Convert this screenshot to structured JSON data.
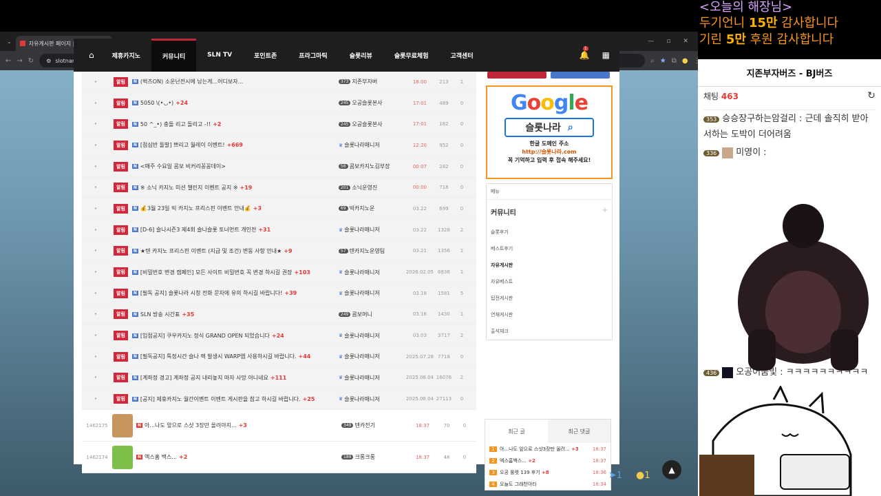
{
  "browser": {
    "tab_title": "자유게시판 페이지 | 슬롯나라",
    "url": "slotnara2.com/free"
  },
  "nav": {
    "items": [
      "제휴카지노",
      "커뮤니티",
      "SLN TV",
      "포인트존",
      "프라그마틱",
      "슬롯리뷰",
      "슬롯무료체험",
      "고객센터"
    ],
    "bell_count": "1"
  },
  "board": {
    "notice_label": "알림",
    "n_icon": "N",
    "notices": [
      {
        "title": "(벅즈ON) 소운난전시에 남는게...어디보자...",
        "cmt": "",
        "lvl": "373",
        "writer": "지존부자버",
        "date": "18:00",
        "date_red": true,
        "views": "213",
        "likes": "1"
      },
      {
        "title": "5050 \\(•◡•)",
        "cmt": "+24",
        "lvl": "245",
        "writer": "오공슬롯본사",
        "date": "17:01",
        "date_red": true,
        "views": "489",
        "likes": "0"
      },
      {
        "title": "50 ^_•) 충돌 리고 돌리고 -!!",
        "cmt": "+2",
        "lvl": "245",
        "writer": "오공슬롯본사",
        "date": "17:01",
        "date_red": true,
        "views": "182",
        "likes": "0"
      },
      {
        "title": "[점심반 돌발] 쁘리고 월레이 이벤트!",
        "cmt": "+669",
        "lvl": "",
        "writer": "슬롯나라매니저",
        "date": "12:20",
        "date_red": true,
        "views": "952",
        "likes": "0"
      },
      {
        "title": "<매주 수요일 콤보 비커리꽁꽁데이>",
        "cmt": "",
        "lvl": "56",
        "writer": "콤보카지노김부장",
        "date": "00:07",
        "date_red": true,
        "views": "282",
        "likes": "0"
      },
      {
        "title": "※ 소닉 카지노 미션 챌린지 이벤트 공지 ※",
        "cmt": "+19",
        "lvl": "201",
        "writer": "소닉운영진",
        "date": "00:00",
        "date_red": true,
        "views": "718",
        "likes": "0"
      },
      {
        "title": "💰3월 23일 빅 카지노 프리스핀 이벤트 안내💰",
        "cmt": "+3",
        "lvl": "69",
        "writer": "빅카지노운",
        "date": "03.22",
        "date_red": false,
        "views": "699",
        "likes": "0"
      },
      {
        "title": "[D-6] 슬나시즌3 제4회 슬나슬롯 토너먼트 개인전",
        "cmt": "+31",
        "lvl": "",
        "writer": "슬롯나라매니저",
        "date": "03.22",
        "date_red": false,
        "views": "1328",
        "likes": "2"
      },
      {
        "title": "★텐 카지노 프리스핀 이벤트 (지급 및 조건) 변동 사항 안내★",
        "cmt": "+9",
        "lvl": "57",
        "writer": "텐카지노운영팀",
        "date": "03.21",
        "date_red": false,
        "views": "1356",
        "likes": "1"
      },
      {
        "title": "[비밀번호 변경 캠페인] 모든 사이트 비밀번호 꼭 변경 하시길 권장",
        "cmt": "+103",
        "lvl": "",
        "writer": "슬롯나라매니저",
        "date": "2026.02.05",
        "date_red": false,
        "views": "6836",
        "likes": "1"
      },
      {
        "title": "[필독 공지] 슬롯나라 시청 전화 문자에 유의 하시길 바랍니다!",
        "cmt": "+39",
        "lvl": "",
        "writer": "슬롯나라매니저",
        "date": "03.18",
        "date_red": false,
        "views": "1581",
        "likes": "5"
      },
      {
        "title": "SLN 방송 시간표",
        "cmt": "+35",
        "lvl": "249",
        "writer": "콤보머니",
        "date": "03.16",
        "date_red": false,
        "views": "1430",
        "likes": "1"
      },
      {
        "title": "[입점공지] 쿠우카지노 정식 GRAND OPEN 되었습니다",
        "cmt": "+24",
        "lvl": "",
        "writer": "슬롯나라매니저",
        "date": "03.03",
        "date_red": false,
        "views": "3717",
        "likes": "2"
      },
      {
        "title": "[필독공지] 특정시간 슬나 렉 발생시 WARP앱 사용하시길 바랍니다.",
        "cmt": "+44",
        "lvl": "",
        "writer": "슬롯나라매니저",
        "date": "2025.07.28",
        "date_red": false,
        "views": "7718",
        "likes": "0"
      },
      {
        "title": "[계좌정 경고] 계좌정 공지 내리놓지 마자 사망 아니네요",
        "cmt": "+111",
        "lvl": "",
        "writer": "슬롯나라매니저",
        "date": "2025.08.04",
        "date_red": false,
        "views": "16076",
        "likes": "2"
      },
      {
        "title": "[공지] 제휴카지노 월간이벤트 이벤트 게시판을 참고 하시길 바랍니다.",
        "cmt": "+25",
        "lvl": "",
        "writer": "슬롯나라매니저",
        "date": "2025.08.04",
        "date_red": false,
        "views": "27113",
        "likes": "0"
      }
    ],
    "posts": [
      {
        "num": "1462175",
        "title": "아...나도 앞으로 스샷 3장만 올려야지...",
        "cmt": "+3",
        "lvl": "349",
        "writer": "텐카전기",
        "date": "18:37",
        "views": "70",
        "likes": "0"
      },
      {
        "num": "1462174",
        "title": "엑스홈 백스...",
        "cmt": "+2",
        "lvl": "189",
        "writer": "크롱크롱",
        "date": "18:37",
        "views": "48",
        "likes": "0"
      }
    ]
  },
  "side": {
    "google": {
      "brand": "Google",
      "search": "슬롯나라",
      "line1": "한글 도메인 주소",
      "line2": "http://슬롯나라.com",
      "line3": "꼭 기억하고 입력 후 접속 해주세요!"
    },
    "menu_head": "메뉴",
    "menu_cat": "커뮤니티",
    "menu_plus": "+",
    "menu_items": [
      "슬롯후기",
      "베스트후기",
      "자유게시판",
      "자유베스트",
      "팁전게시판",
      "연재게시판",
      "출석체크"
    ],
    "recent_tabs": [
      "최근 글",
      "최근 댓글"
    ],
    "recent": [
      {
        "n": "1",
        "title": "아...나도 앞으로 스샷3장만 올려...",
        "cmt": "+3",
        "time": "18:37"
      },
      {
        "n": "2",
        "title": "엑스홈백스...",
        "cmt": "+2",
        "time": "18:37"
      },
      {
        "n": "3",
        "title": "오공 롤렛 139 후기",
        "cmt": "+8",
        "time": "18:36"
      },
      {
        "n": "4",
        "title": "오늘도 그래찬아타",
        "cmt": "",
        "time": "18:34"
      }
    ]
  },
  "float": {
    "share_count": "1",
    "comment_count": "1"
  },
  "stream": {
    "banner_title": "<오늘의 해장님>",
    "banner_line1_a": "두기언니 ",
    "banner_line1_b": "15만",
    "banner_line1_c": " 감사합니다",
    "banner_line2_a": "기린 ",
    "banner_line2_b": "5만",
    "banner_line2_c": " 후원 감사합니다"
  },
  "chat": {
    "title": "지존부자버즈 - BJ버즈",
    "count_label": "채팅",
    "count": "463",
    "messages": [
      {
        "lv": "353",
        "nick": "승승장구하는암걸리",
        "text": "근데 솔직히 받아서하는 도박이 더어려움"
      },
      {
        "lv": "336",
        "nick": "미영이",
        "text": ""
      },
      {
        "lv": "436",
        "nick": "오공어둠빛",
        "text": "ㅋㅋㅋㅋㅋㅋㅋㅋㅋㅋ"
      }
    ]
  }
}
